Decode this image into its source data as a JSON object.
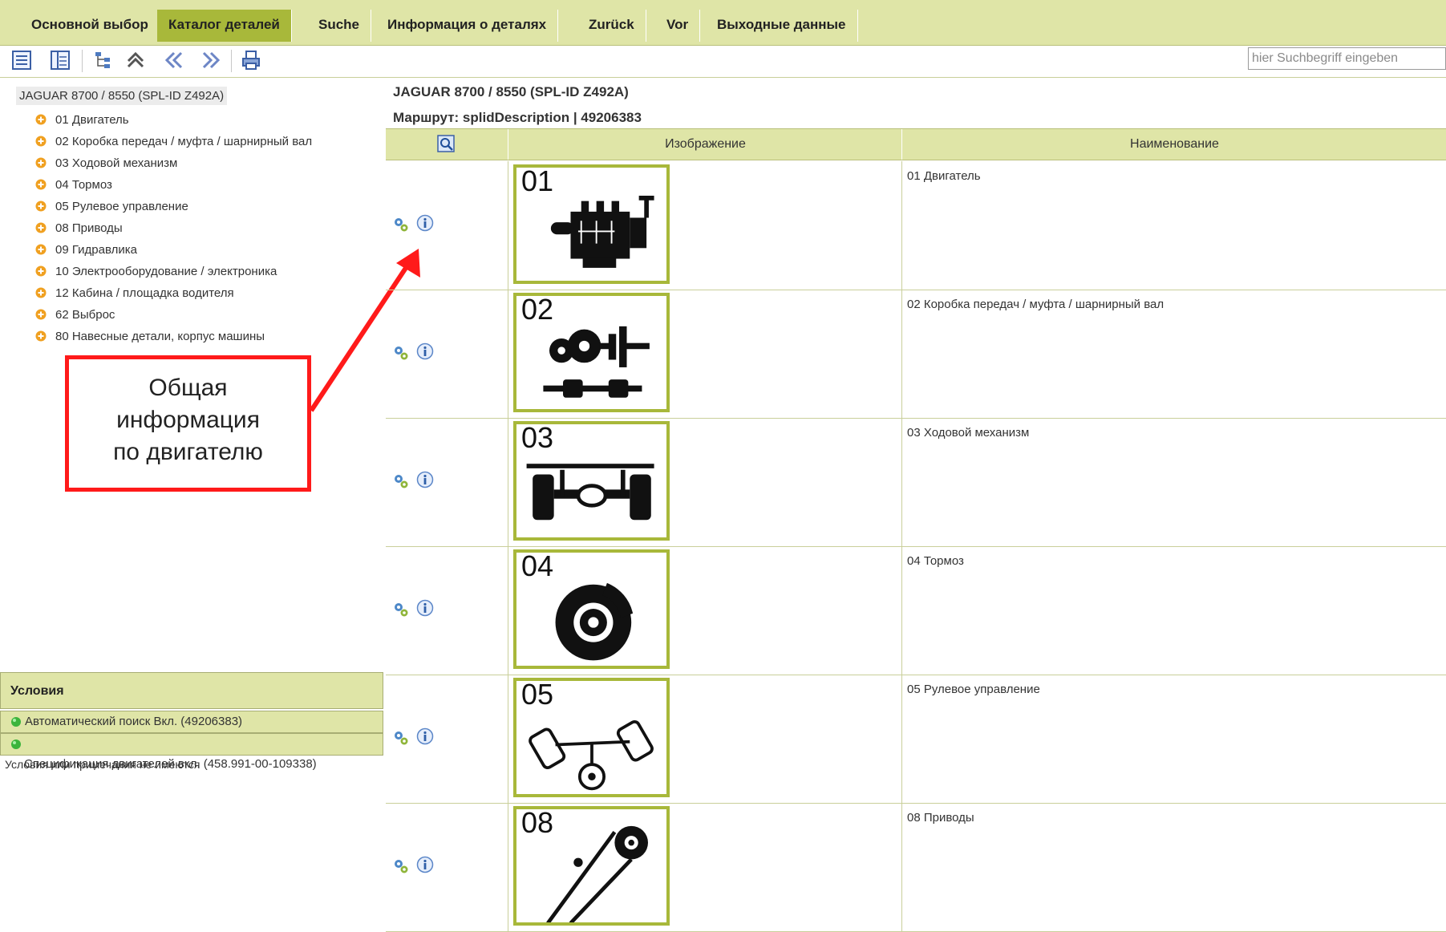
{
  "menu": [
    {
      "label": "Основной выбор",
      "active": false
    },
    {
      "label": "Каталог деталей",
      "active": true
    },
    {
      "label": "Suche",
      "active": false
    },
    {
      "label": "Информация о деталях",
      "active": false
    },
    {
      "label": "Zurück",
      "active": false
    },
    {
      "label": "Vor",
      "active": false
    },
    {
      "label": "Выходные данные",
      "active": false
    }
  ],
  "toolbar": {
    "icons": [
      "list-view-icon",
      "detail-view-icon",
      "tree-structure-icon",
      "up-level-icon",
      "back-double-icon",
      "forward-double-icon",
      "print-icon"
    ],
    "search_placeholder": "hier Suchbegriff eingeben"
  },
  "tree": {
    "root": "JAGUAR 8700 / 8550   (SPL-ID Z492A)",
    "items": [
      "01 Двигатель",
      "02 Коробка передач / муфта / шарнирный вал",
      "03 Ходовой механизм",
      "04 Тормоз",
      "05 Рулевое управление",
      "08 Приводы",
      "09 Гидравлика",
      "10 Электрооборудование / электроника",
      "12 Кабина / площадка водителя",
      "62 Выброс",
      "80 Навесные детали, корпус машины"
    ]
  },
  "annotation": {
    "line1": "Общая",
    "line2": "информация",
    "line3": "по двигателю"
  },
  "conditions": {
    "title": "Условия",
    "items": [
      "Автоматический поиск Вкл. (49206383)",
      ""
    ],
    "spec": "Спецификация двигателей вкл. (458.991-00-109338)",
    "note": "Условия или примечания не имеются"
  },
  "main": {
    "title": "JAGUAR 8700 / 8550   (SPL-ID Z492A)",
    "route": "Маршрут: splidDescription | 49206383",
    "columns": {
      "image": "Изображение",
      "name": "Наименование"
    },
    "rows": [
      {
        "num": "01",
        "name": "01 Двигатель"
      },
      {
        "num": "02",
        "name": "02 Коробка передач / муфта / шарнирный вал"
      },
      {
        "num": "03",
        "name": "03 Ходовой механизм"
      },
      {
        "num": "04",
        "name": "04 Тормоз"
      },
      {
        "num": "05",
        "name": "05 Рулевое управление"
      },
      {
        "num": "08",
        "name": "08 Приводы"
      }
    ]
  },
  "colors": {
    "menu_bg": "#dfe5a7",
    "menu_active": "#a8b83a",
    "annotation_red": "#ff1a1a",
    "tree_dot": "#f0a020",
    "status_green": "#3cb43c"
  }
}
